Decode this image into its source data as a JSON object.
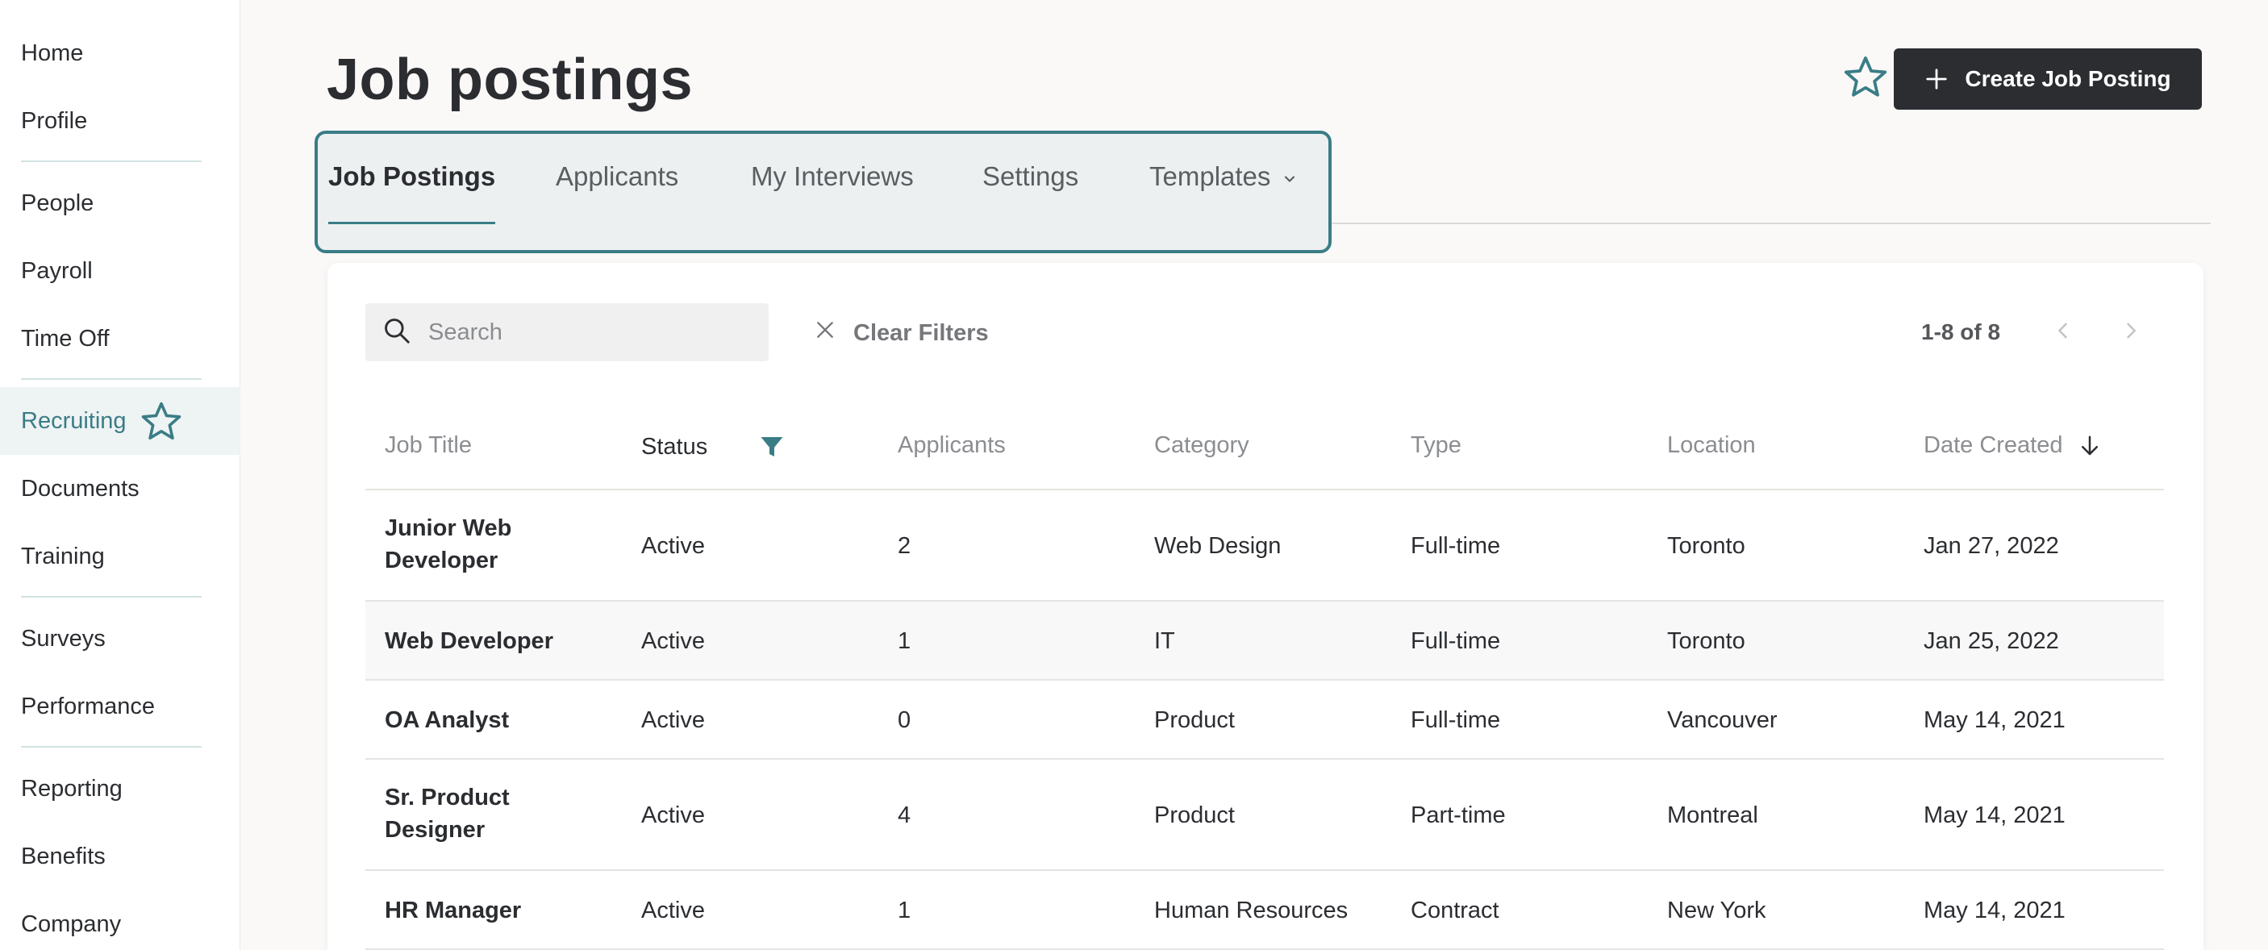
{
  "sidebar": {
    "items": [
      {
        "label": "Home"
      },
      {
        "label": "Profile"
      },
      {
        "label": "People"
      },
      {
        "label": "Payroll"
      },
      {
        "label": "Time Off"
      },
      {
        "label": "Recruiting"
      },
      {
        "label": "Documents"
      },
      {
        "label": "Training"
      },
      {
        "label": "Surveys"
      },
      {
        "label": "Performance"
      },
      {
        "label": "Reporting"
      },
      {
        "label": "Benefits"
      },
      {
        "label": "Company"
      }
    ],
    "active": "Recruiting"
  },
  "header": {
    "title": "Job postings",
    "create_label": "Create Job Posting"
  },
  "tabs": [
    {
      "label": "Job Postings"
    },
    {
      "label": "Applicants"
    },
    {
      "label": "My Interviews"
    },
    {
      "label": "Settings"
    },
    {
      "label": "Templates"
    }
  ],
  "toolbar": {
    "search_placeholder": "Search",
    "clear_filters": "Clear Filters",
    "pagination": "1-8 of 8"
  },
  "table": {
    "columns": [
      "Job Title",
      "Status",
      "Applicants",
      "Category",
      "Type",
      "Location",
      "Date Created"
    ],
    "rows": [
      {
        "title": "Junior Web Developer",
        "status": "Active",
        "applicants": "2",
        "category": "Web Design",
        "type": "Full-time",
        "location": "Toronto",
        "date": "Jan 27, 2022"
      },
      {
        "title": "Web Developer",
        "status": "Active",
        "applicants": "1",
        "category": "IT",
        "type": "Full-time",
        "location": "Toronto",
        "date": "Jan 25, 2022"
      },
      {
        "title": "OA Analyst",
        "status": "Active",
        "applicants": "0",
        "category": "Product",
        "type": "Full-time",
        "location": "Vancouver",
        "date": "May 14, 2021"
      },
      {
        "title": "Sr. Product Designer",
        "status": "Active",
        "applicants": "4",
        "category": "Product",
        "type": "Part-time",
        "location": "Montreal",
        "date": "May 14, 2021"
      },
      {
        "title": "HR Manager",
        "status": "Active",
        "applicants": "1",
        "category": "Human Resources",
        "type": "Contract",
        "location": "New York",
        "date": "May 14, 2021"
      }
    ]
  },
  "colors": {
    "accent": "#3a7d86",
    "dark": "#2b2d31",
    "active_nav_bg": "#eef3f3"
  },
  "icons": [
    "star-icon",
    "plus-icon",
    "chevron-down-icon",
    "search-icon",
    "close-icon",
    "chevron-left-icon",
    "chevron-right-icon",
    "filter-icon",
    "arrow-down-icon"
  ]
}
